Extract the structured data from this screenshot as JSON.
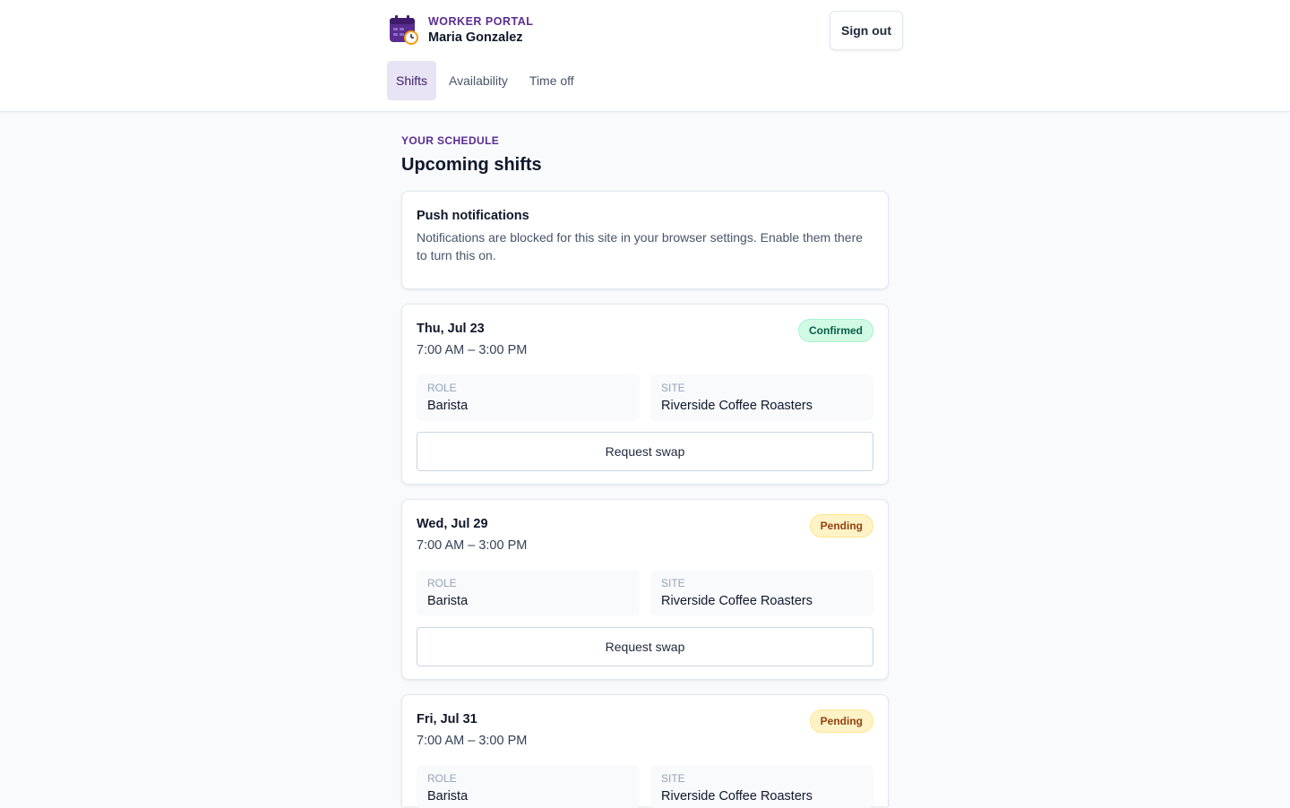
{
  "header": {
    "brand_label": "WORKER PORTAL",
    "user_name": "Maria Gonzalez",
    "sign_out": "Sign out",
    "brand_color": "#5b2d90"
  },
  "tabs": [
    {
      "label": "Shifts",
      "active": true
    },
    {
      "label": "Availability",
      "active": false
    },
    {
      "label": "Time off",
      "active": false
    }
  ],
  "main": {
    "eyebrow": "YOUR SCHEDULE",
    "title": "Upcoming shifts"
  },
  "notification": {
    "title": "Push notifications",
    "body": "Notifications are blocked for this site in your browser settings. Enable them there to turn this on."
  },
  "shift_labels": {
    "role": "ROLE",
    "site": "SITE",
    "swap_button": "Request swap"
  },
  "shifts": [
    {
      "date": "Thu, Jul 23",
      "time": "7:00 AM – 3:00 PM",
      "status": "Confirmed",
      "role": "Barista",
      "site": "Riverside Coffee Roasters"
    },
    {
      "date": "Wed, Jul 29",
      "time": "7:00 AM – 3:00 PM",
      "status": "Pending",
      "role": "Barista",
      "site": "Riverside Coffee Roasters"
    },
    {
      "date": "Fri, Jul 31",
      "time": "7:00 AM – 3:00 PM",
      "status": "Pending",
      "role": "Barista",
      "site": "Riverside Coffee Roasters"
    }
  ],
  "colors": {
    "confirmed": "#d1fae5",
    "pending": "#fef3c7",
    "active_tab": "#e9e4f5"
  }
}
